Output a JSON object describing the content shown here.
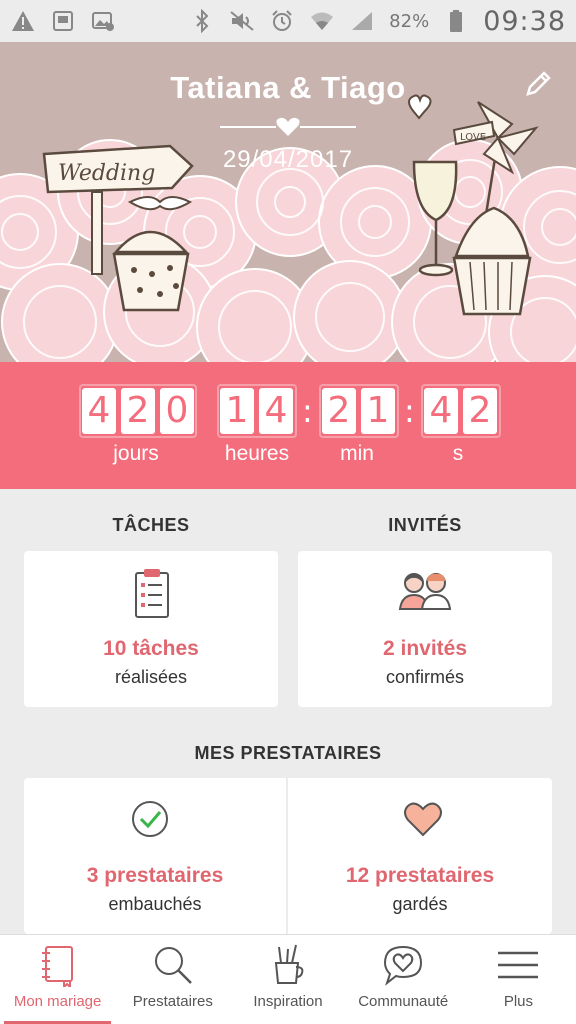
{
  "status_bar": {
    "icons": [
      "warning-icon",
      "photo-icon",
      "image-icon",
      "bluetooth-icon",
      "mute-icon",
      "alarm-icon",
      "wifi-icon",
      "signal-icon",
      "battery-icon"
    ],
    "battery": "82%",
    "time": "09:38"
  },
  "hero": {
    "couple": "Tatiana & Tiago",
    "date": "29/04/2017",
    "sign_text": "Wedding",
    "flag_text": "LOVE"
  },
  "countdown": {
    "days": [
      "4",
      "2",
      "0"
    ],
    "hours": [
      "1",
      "4"
    ],
    "minutes": [
      "2",
      "1"
    ],
    "seconds": [
      "4",
      "2"
    ],
    "separator": ":",
    "labels": {
      "days": "jours",
      "hours": "heures",
      "minutes": "min",
      "seconds": "s"
    }
  },
  "tasks": {
    "title": "TÂCHES",
    "count": "10 tâches",
    "sub": "réalisées"
  },
  "guests": {
    "title": "INVITÉS",
    "count": "2 invités",
    "sub": "confirmés"
  },
  "vendors": {
    "title": "MES PRESTATAIRES",
    "hired": {
      "count": "3 prestataires",
      "sub": "embauchés"
    },
    "saved": {
      "count": "12 prestataires",
      "sub": "gardés"
    }
  },
  "nav": {
    "items": [
      {
        "label": "Mon mariage",
        "icon": "notebook-icon"
      },
      {
        "label": "Prestataires",
        "icon": "search-icon"
      },
      {
        "label": "Inspiration",
        "icon": "pencil-cup-icon"
      },
      {
        "label": "Communauté",
        "icon": "chat-heart-icon"
      },
      {
        "label": "Plus",
        "icon": "menu-icon"
      }
    ]
  },
  "colors": {
    "accent": "#f36d7d",
    "accent_text": "#e06670",
    "hero_bg": "#c9b3ae",
    "page_bg": "#ececec"
  }
}
